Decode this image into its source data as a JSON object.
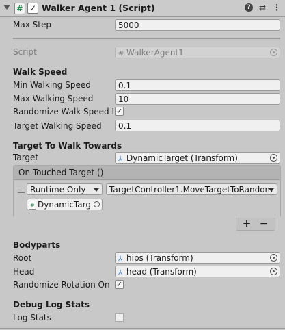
{
  "header": {
    "title": "Walker Agent 1 (Script)",
    "script_icon": "#",
    "enabled_mark": "✓",
    "help_icon": "?",
    "preset_icon": "⇄",
    "more_icon": "⋮"
  },
  "max_step": {
    "label": "Max Step",
    "value": "5000"
  },
  "script": {
    "label": "Script",
    "value": "WalkerAgent1",
    "icon": "#"
  },
  "walk_speed": {
    "header": "Walk Speed",
    "min": {
      "label": "Min Walking Speed",
      "value": "0.1"
    },
    "max": {
      "label": "Max Walking Speed",
      "value": "10"
    },
    "randomize": {
      "label": "Randomize Walk Speed Ea",
      "checked": "✓"
    },
    "target": {
      "label": "Target Walking Speed",
      "value": "0.1"
    }
  },
  "target_section": {
    "header": "Target To Walk Towards",
    "target": {
      "label": "Target",
      "value": "DynamicTarget (Transform)",
      "icon": "⅄"
    },
    "event": {
      "header": "On Touched Target ()",
      "runtime": "Runtime Only",
      "function": "TargetController1.MoveTargetToRandom",
      "object": "DynamicTarg",
      "object_icon": "#"
    },
    "plus": "+",
    "minus": "−"
  },
  "bodyparts": {
    "header": "Bodyparts",
    "root": {
      "label": "Root",
      "value": "hips (Transform)",
      "icon": "⅄"
    },
    "head": {
      "label": "Head",
      "value": "head (Transform)",
      "icon": "⅄"
    },
    "randomize_rotation": {
      "label": "Randomize Rotation On Ep",
      "checked": "✓"
    }
  },
  "debug": {
    "header": "Debug Log Stats",
    "log_stats": {
      "label": "Log Stats",
      "checked": ""
    }
  }
}
